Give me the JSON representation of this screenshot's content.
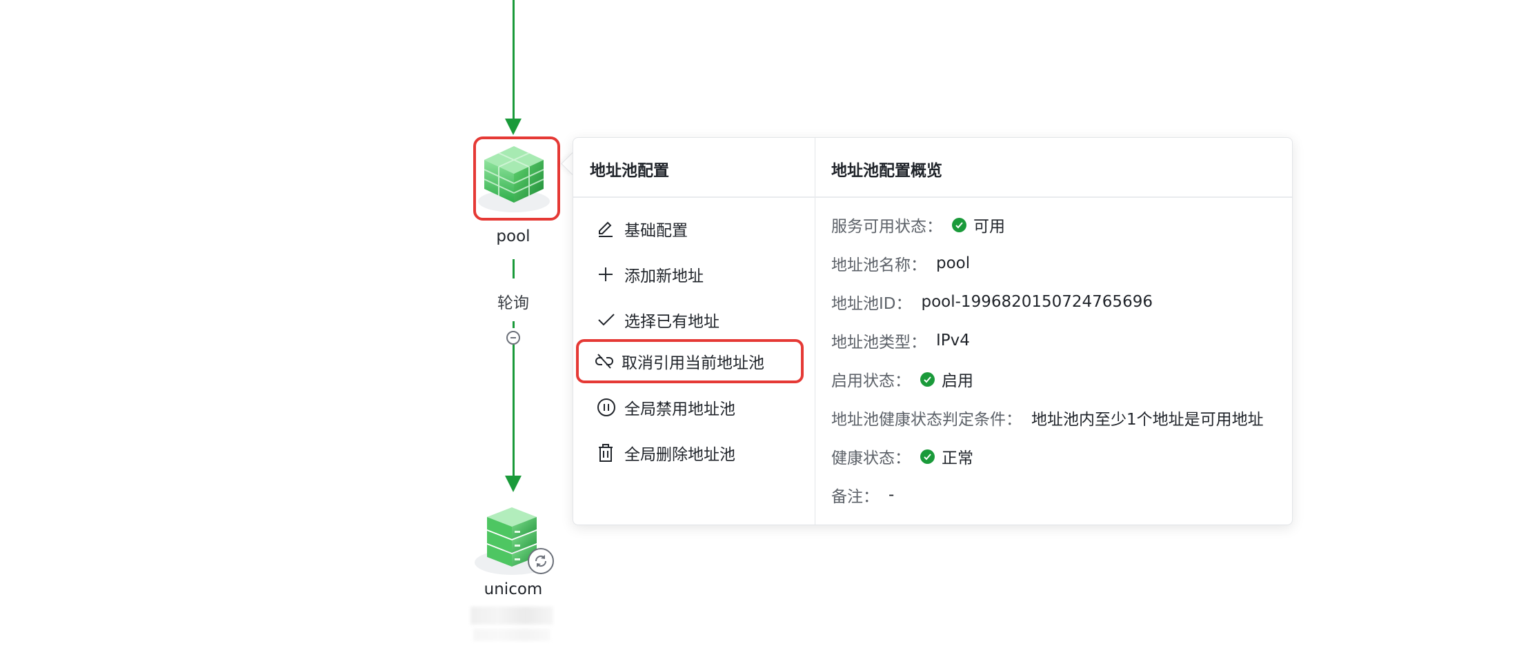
{
  "nodes": {
    "pool": {
      "label": "pool"
    },
    "unicom": {
      "label": "unicom"
    }
  },
  "edge": {
    "label": "轮询"
  },
  "colors": {
    "flow_green": "#1a9a3a",
    "highlight_red": "#e53935",
    "status_ok": "#1a9a3a"
  },
  "popover": {
    "left_title": "地址池配置",
    "right_title": "地址池配置概览",
    "menu": [
      {
        "label": "基础配置",
        "icon": "edit-icon"
      },
      {
        "label": "添加新地址",
        "icon": "plus-icon"
      },
      {
        "label": "选择已有地址",
        "icon": "check-icon"
      },
      {
        "label": "取消引用当前地址池",
        "icon": "unlink-icon"
      },
      {
        "label": "全局禁用地址池",
        "icon": "pause-circle-icon"
      },
      {
        "label": "全局删除地址池",
        "icon": "trash-icon"
      }
    ],
    "overview": [
      {
        "key": "服务可用状态：",
        "value": "可用",
        "status": "ok"
      },
      {
        "key": "地址池名称：",
        "value": "pool"
      },
      {
        "key": "地址池ID：",
        "value": "pool-1996820150724765696"
      },
      {
        "key": "地址池类型：",
        "value": "IPv4"
      },
      {
        "key": "启用状态：",
        "value": "启用",
        "status": "ok"
      },
      {
        "key": "地址池健康状态判定条件：",
        "value": "地址池内至少1个地址是可用地址"
      },
      {
        "key": "健康状态：",
        "value": "正常",
        "status": "ok"
      },
      {
        "key": "备注：",
        "value": "-"
      }
    ]
  }
}
